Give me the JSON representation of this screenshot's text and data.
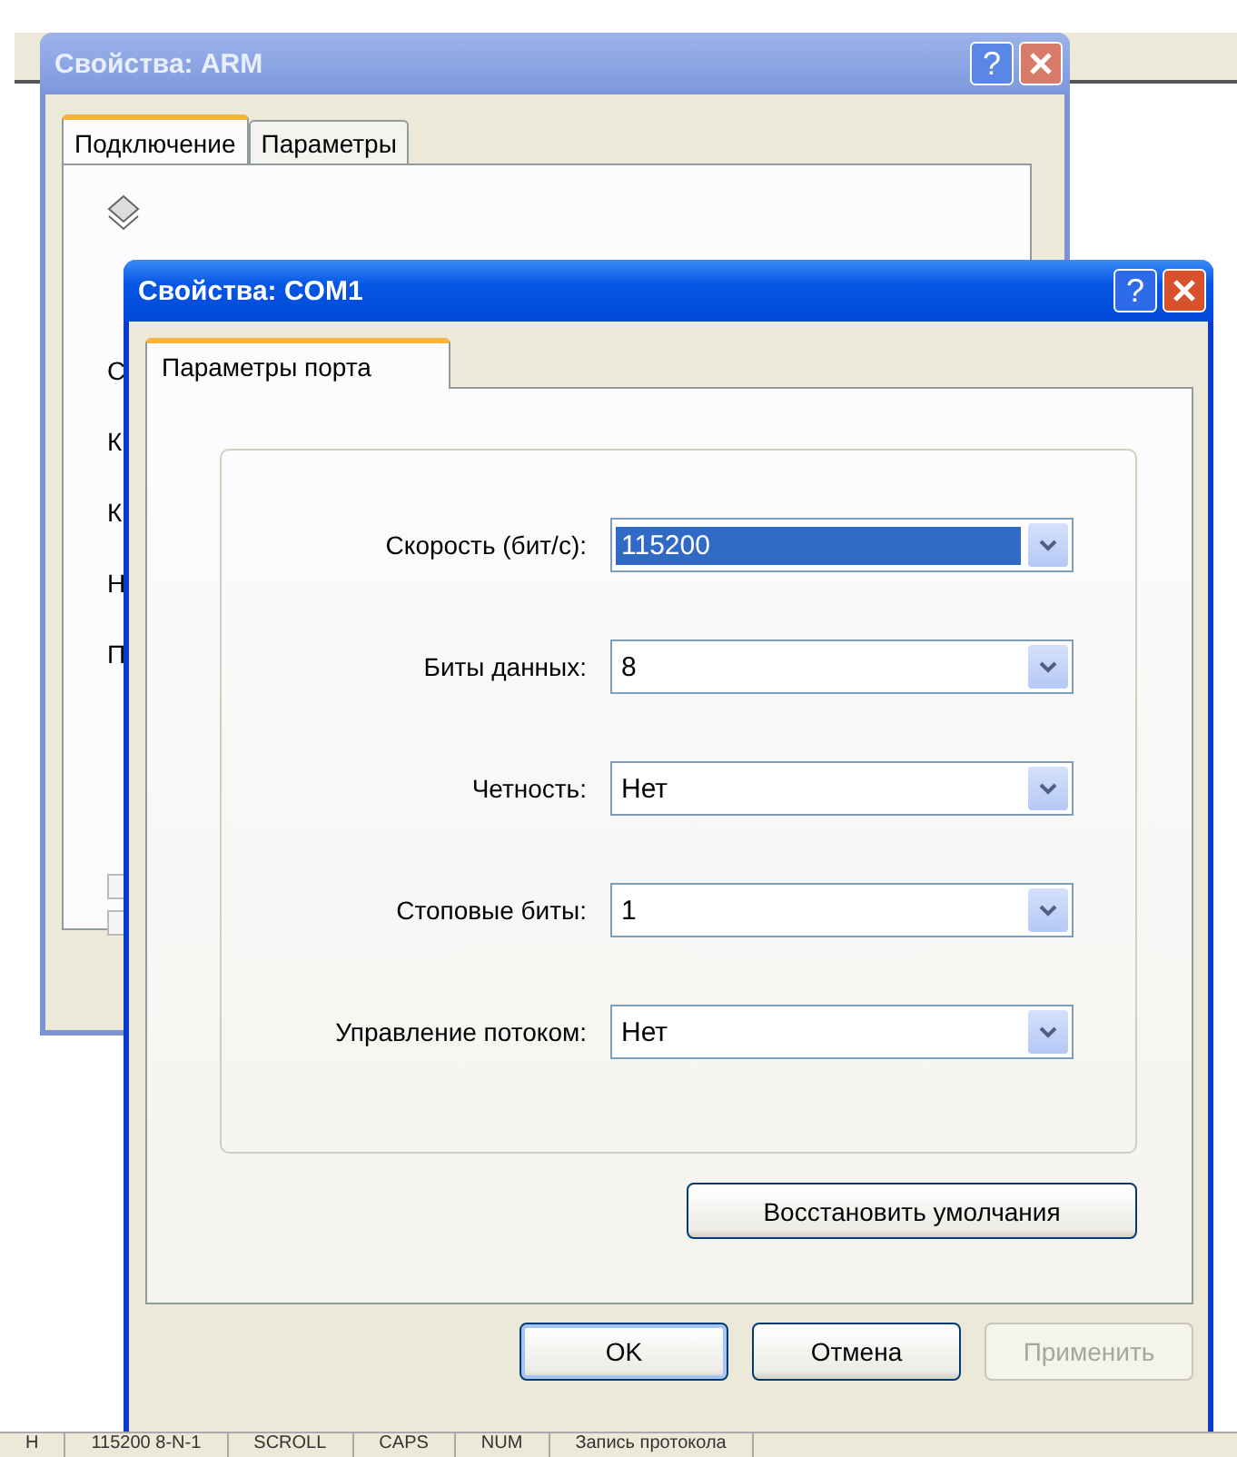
{
  "background_window": {
    "title": "Свойства: ARM",
    "active": false,
    "help": "?",
    "tabs": [
      {
        "label": "Подключение",
        "selected": true
      },
      {
        "label": "Параметры",
        "selected": false
      }
    ],
    "cut_labels": [
      "С",
      "К",
      "К",
      "Н",
      "П"
    ]
  },
  "dialog": {
    "title": "Свойства: COM1",
    "active": true,
    "help": "?",
    "tabs": [
      {
        "label": "Параметры порта",
        "selected": true
      }
    ],
    "settings": [
      {
        "label": "Скорость (бит/с):",
        "value": "115200",
        "selected": true
      },
      {
        "label": "Биты данных:",
        "value": "8",
        "selected": false
      },
      {
        "label": "Четность:",
        "value": "Нет",
        "selected": false
      },
      {
        "label": "Стоповые биты:",
        "value": "1",
        "selected": false
      },
      {
        "label": "Управление потоком:",
        "value": "Нет",
        "selected": false
      }
    ],
    "restore_button": "Восстановить умолчания",
    "buttons": [
      {
        "label": "OK",
        "default": true,
        "disabled": false
      },
      {
        "label": "Отмена",
        "default": false,
        "disabled": false
      },
      {
        "label": "Применить",
        "default": false,
        "disabled": true
      }
    ]
  },
  "status_bar": [
    "Н",
    "115200 8-N-1",
    "SCROLL",
    "CAPS",
    "NUM",
    "Запись протокола"
  ]
}
